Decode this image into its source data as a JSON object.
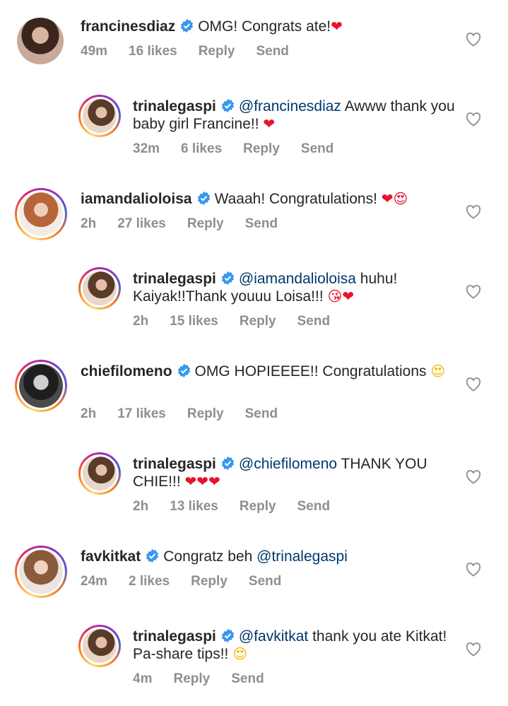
{
  "comments": [
    {
      "username": "francinesdiaz",
      "text": "OMG! Congrats ate!",
      "emoji": "❤",
      "time": "49m",
      "likes": "16 likes",
      "reply": "Reply",
      "send": "Send"
    },
    {
      "username": "trinalegaspi",
      "mention": "@francinesdiaz",
      "text": " Awww thank you baby girl Francine!! ",
      "emoji": "❤",
      "time": "32m",
      "likes": "6 likes",
      "reply": "Reply",
      "send": "Send"
    },
    {
      "username": "iamandalioloisa",
      "text": "Waaah! Congratulations! ",
      "emoji": "❤😍",
      "time": "2h",
      "likes": "27 likes",
      "reply": "Reply",
      "send": "Send"
    },
    {
      "username": "trinalegaspi",
      "mention": "@iamandalioloisa",
      "text": " huhu! Kaiyak!!Thank youuu Loisa!!! ",
      "emoji": "😘❤",
      "time": "2h",
      "likes": "15 likes",
      "reply": "Reply",
      "send": "Send"
    },
    {
      "username": "chiefilomeno",
      "text": "OMG HOPIEEEE!! Congratulations ",
      "emoji": "😍",
      "time": "2h",
      "likes": "17 likes",
      "reply": "Reply",
      "send": "Send"
    },
    {
      "username": "trinalegaspi",
      "mention": "@chiefilomeno",
      "text": " THANK YOU CHIE!!! ",
      "emoji": "❤❤❤",
      "time": "2h",
      "likes": "13 likes",
      "reply": "Reply",
      "send": "Send"
    },
    {
      "username": "favkitkat",
      "text": "Congratz beh ",
      "mention": "@trinalegaspi",
      "emoji": "",
      "time": "24m",
      "likes": "2 likes",
      "reply": "Reply",
      "send": "Send"
    },
    {
      "username": "trinalegaspi",
      "mention": "@favkitkat",
      "text": " thank you ate Kitkat! Pa-share tips!! ",
      "emoji": "😍",
      "time": "4m",
      "likes": "",
      "reply": "Reply",
      "send": "Send"
    }
  ],
  "colors": {
    "mention": "#00376b",
    "meta": "#8e8e8e",
    "verified": "#3897f0"
  }
}
